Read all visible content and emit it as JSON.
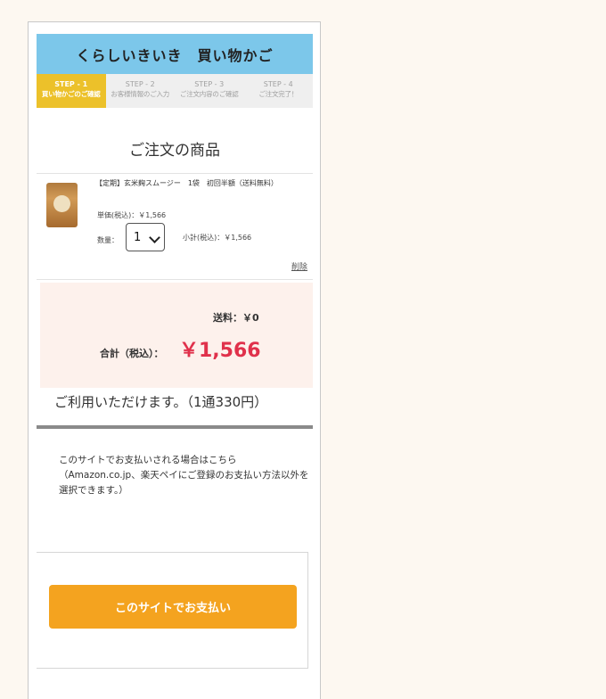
{
  "cart": {
    "title": "くらしいきいき　買い物かご",
    "steps": [
      {
        "num": "STEP - 1",
        "label": "買い物かごのご確認"
      },
      {
        "num": "STEP - 2",
        "label": "お客様情報のご入力"
      },
      {
        "num": "STEP - 3",
        "label": "ご注文内容のご確認"
      },
      {
        "num": "STEP - 4",
        "label": "ご注文完了！"
      }
    ]
  },
  "order": {
    "section_title": "ご注文の商品",
    "product_name": "【定期】玄米麹スムージー　1袋　初回半額（送料無料）",
    "unit_price": "単価(税込)：￥1,566",
    "qty_label": "数量：",
    "qty_value": "1",
    "subtotal": "小計(税込)：￥1,566",
    "delete_label": "削除"
  },
  "totals": {
    "shipping": "送料：￥0",
    "total_label": "合計（税込）：",
    "total_value": "￥1,566"
  },
  "notice": "ご利用いただけます。（1通330円）",
  "payment": {
    "description": "このサイトでお支払いされる場合はこちら（Amazon.co.jp、楽天ペイにご登録のお支払い方法以外を選択できます。）",
    "button_label": "このサイトでお支払い"
  },
  "colors": {
    "header_bg": "#7cc7ea",
    "active_step": "#ecc12a",
    "total_price": "#e0314b",
    "pay_button": "#f4a31f"
  }
}
